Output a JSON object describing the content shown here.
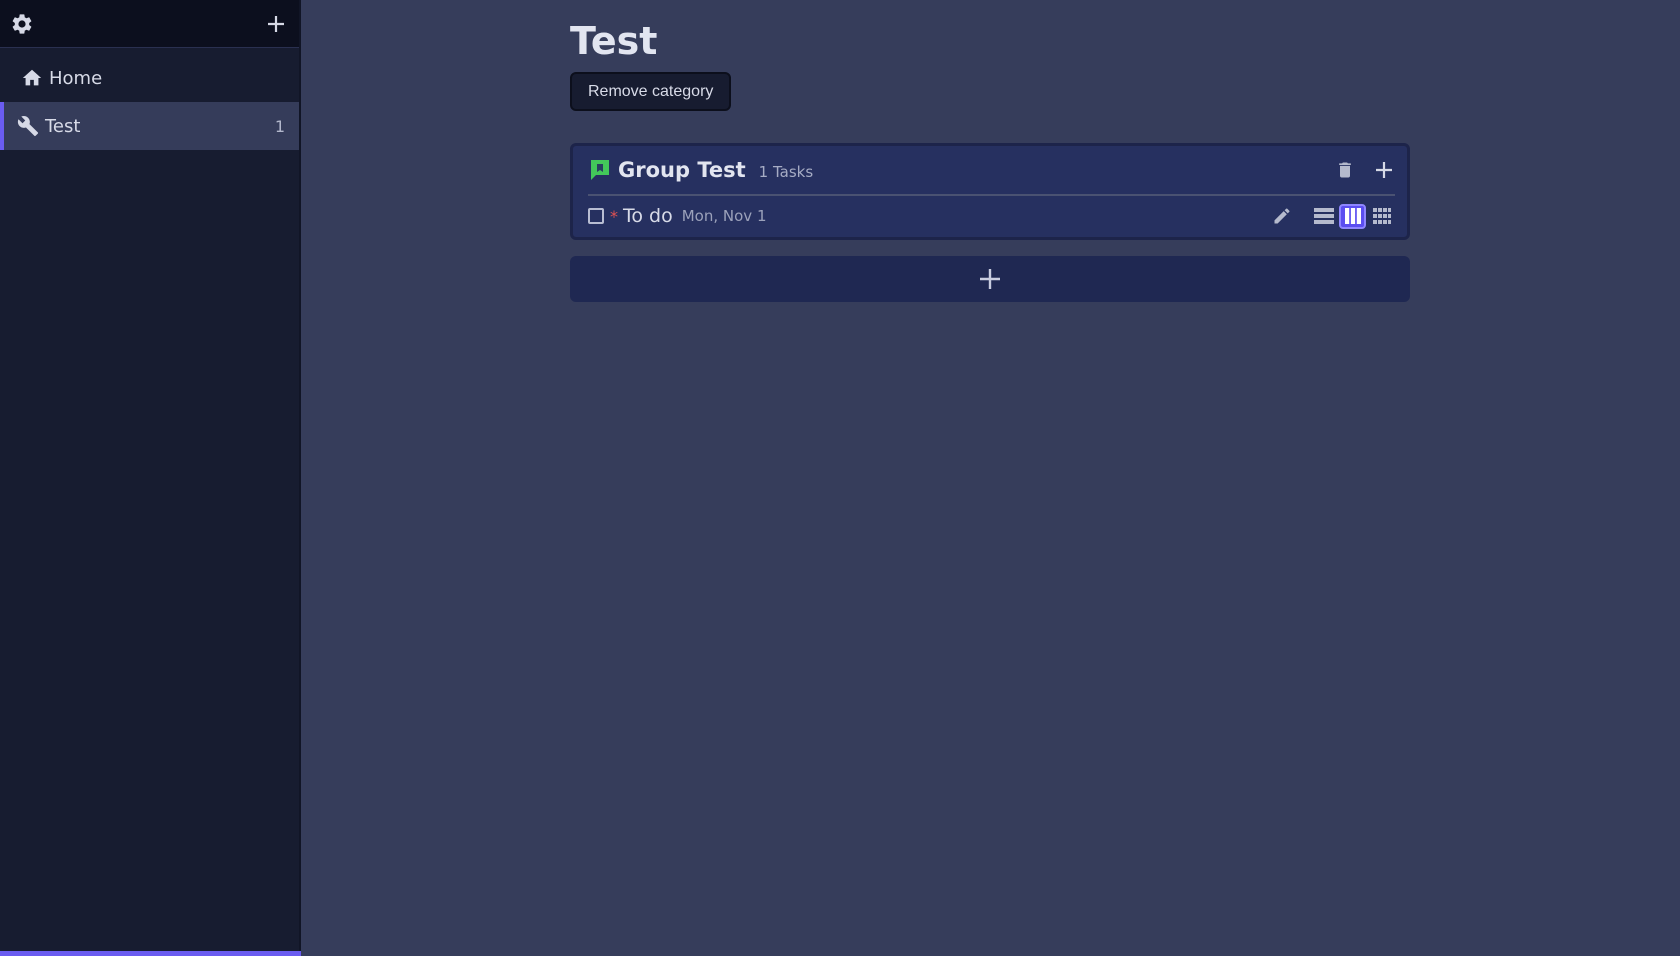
{
  "sidebar": {
    "items": [
      {
        "label": "Home",
        "icon": "home-icon",
        "count": ""
      },
      {
        "label": "Test",
        "icon": "wrench-icon",
        "count": "1"
      }
    ]
  },
  "main": {
    "title": "Test",
    "remove_label": "Remove category",
    "group": {
      "title": "Group Test",
      "count_label": "1 Tasks",
      "flag_color": "#43c85a",
      "tasks": [
        {
          "priority": "*",
          "title": "To do",
          "date": "Mon, Nov 1"
        }
      ]
    }
  },
  "colors": {
    "accent": "#6a5cf0",
    "priority": "#e05252"
  }
}
